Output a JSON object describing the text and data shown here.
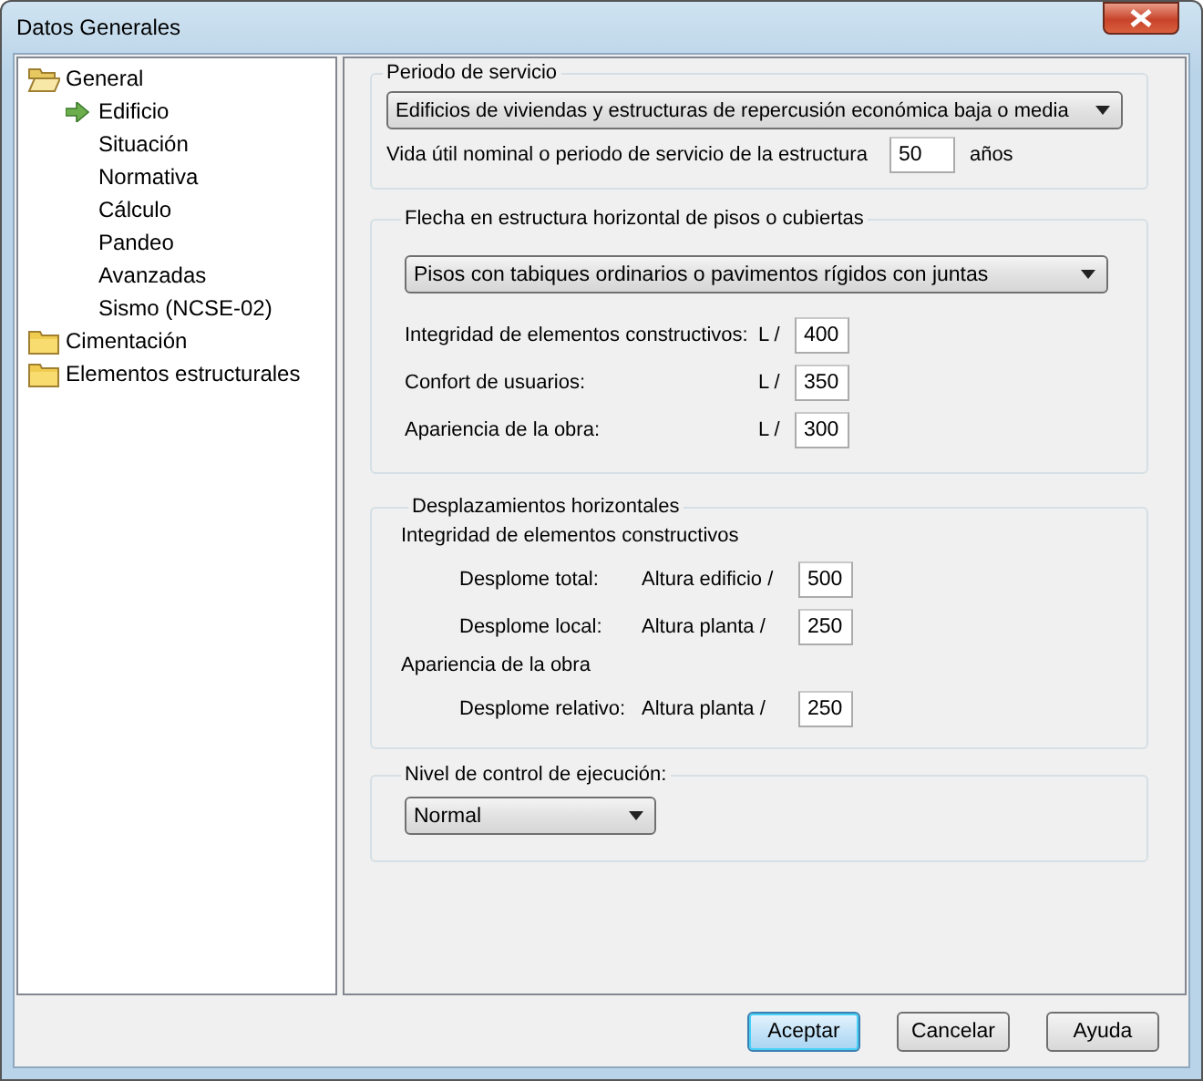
{
  "window": {
    "title": "Datos Generales"
  },
  "tree": [
    {
      "label": "General",
      "expanded": true,
      "children": [
        {
          "label": "Edificio",
          "selected": true
        },
        {
          "label": "Situación",
          "selected": false
        },
        {
          "label": "Normativa",
          "selected": false
        },
        {
          "label": "Cálculo",
          "selected": false
        },
        {
          "label": "Pandeo",
          "selected": false
        },
        {
          "label": "Avanzadas",
          "selected": false
        },
        {
          "label": "Sismo (NCSE-02)",
          "selected": false
        }
      ]
    },
    {
      "label": "Cimentación",
      "expanded": false
    },
    {
      "label": "Elementos estructurales",
      "expanded": false
    }
  ],
  "periodo": {
    "title": "Periodo de servicio",
    "dropdown": "Edificios de viviendas y estructuras de repercusión económica baja o media",
    "life_label": "Vida útil nominal o periodo de servicio de la estructura",
    "life_value": "50",
    "unit": "años"
  },
  "flecha": {
    "title": "Flecha en estructura horizontal de pisos o cubiertas",
    "dropdown": "Pisos con tabiques ordinarios o pavimentos rígidos con juntas",
    "rows": [
      {
        "label": "Integridad de elementos constructivos:",
        "prefix": "L /",
        "value": "400"
      },
      {
        "label": "Confort de usuarios:",
        "prefix": "L /",
        "value": "350"
      },
      {
        "label": "Apariencia de la obra:",
        "prefix": "L /",
        "value": "300"
      }
    ]
  },
  "desplazamientos": {
    "title": "Desplazamientos horizontales",
    "groups": [
      {
        "title": "Integridad de elementos constructivos",
        "rows": [
          {
            "label": "Desplome total:",
            "prefix": "Altura edificio /",
            "value": "500"
          },
          {
            "label": "Desplome local:",
            "prefix": "Altura planta  /",
            "value": "250"
          }
        ]
      },
      {
        "title": "Apariencia de la obra",
        "rows": [
          {
            "label": "Desplome relativo:",
            "prefix": "Altura planta  /",
            "value": "250"
          }
        ]
      }
    ]
  },
  "nivel": {
    "title": "Nivel de control de ejecución:",
    "dropdown": "Normal"
  },
  "buttons": [
    {
      "label": "Aceptar",
      "default": true
    },
    {
      "label": "Cancelar",
      "default": false
    },
    {
      "label": "Ayuda",
      "default": false
    }
  ]
}
